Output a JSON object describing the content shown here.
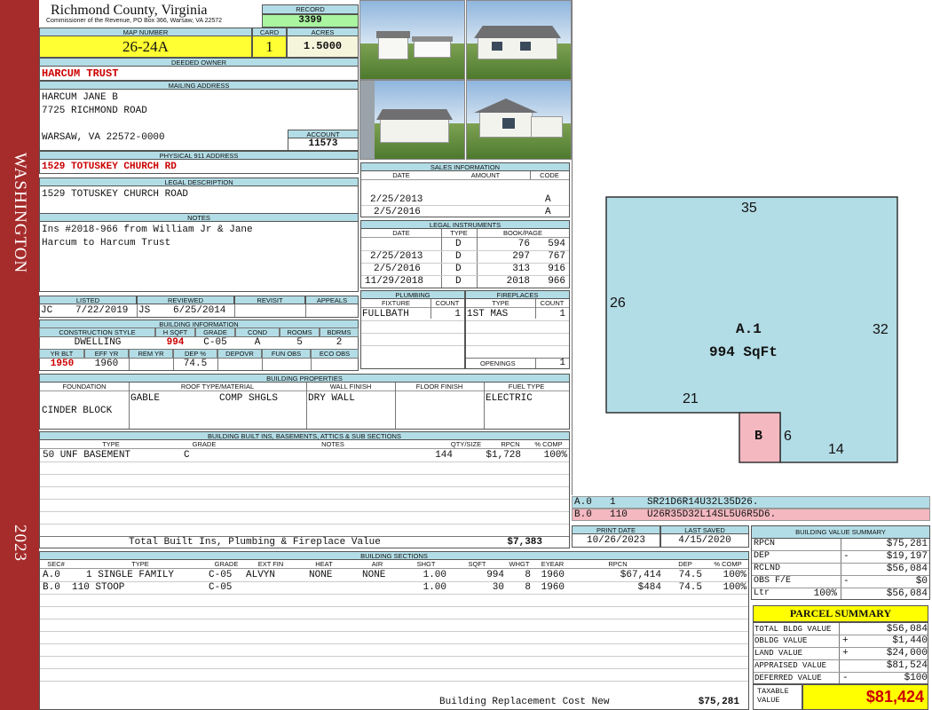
{
  "side": {
    "top": "WASHINGTON",
    "bottom": "2023"
  },
  "header": {
    "county": "Richmond County, Virginia",
    "commissioner": "Commissioner of the Revenue, PO Box 366, Warsaw, VA 22572",
    "record_label": "RECORD",
    "record": "3399",
    "map_label": "MAP NUMBER",
    "map": "26-24A",
    "card_label": "CARD",
    "card": "1",
    "acres_label": "ACRES",
    "acres": "1.5000"
  },
  "owner": {
    "label": "DEEDED OWNER",
    "name": "HARCUM TRUST"
  },
  "mailing": {
    "label": "MAILING ADDRESS",
    "line1": "HARCUM JANE B",
    "line2": "7725 RICHMOND ROAD",
    "line3": "WARSAW, VA 22572-0000",
    "account_label": "ACCOUNT",
    "account": "11573"
  },
  "physical": {
    "label": "PHYSICAL 911 ADDRESS",
    "address": "1529 TOTUSKEY CHURCH RD"
  },
  "legal": {
    "label": "LEGAL DESCRIPTION",
    "text": "1529 TOTUSKEY CHURCH ROAD"
  },
  "notes": {
    "label": "NOTES",
    "line1": "Ins #2018-966 from William Jr & Jane",
    "line2": "Harcum to Harcum Trust"
  },
  "sales": {
    "title": "SALES INFORMATION",
    "headers": [
      "DATE",
      "AMOUNT",
      "CODE"
    ],
    "rows": [
      {
        "date": "2/25/2013",
        "amount": "",
        "code": "A"
      },
      {
        "date": "2/5/2016",
        "amount": "",
        "code": "A"
      }
    ]
  },
  "legal_instruments": {
    "title": "LEGAL INSTRUMENTS",
    "headers": [
      "DATE",
      "TYPE",
      "BOOK/PAGE"
    ],
    "rows": [
      {
        "date": "",
        "type": "D",
        "book": "76",
        "page": "594"
      },
      {
        "date": "2/25/2013",
        "type": "D",
        "book": "297",
        "page": "767"
      },
      {
        "date": "2/5/2016",
        "type": "D",
        "book": "313",
        "page": "916"
      },
      {
        "date": "11/29/2018",
        "type": "D",
        "book": "2018",
        "page": "966"
      }
    ]
  },
  "listing": {
    "listed_label": "LISTED",
    "listed_by": "JC",
    "listed_date": "7/22/2019",
    "reviewed_label": "REVIEWED",
    "reviewed_by": "JS",
    "reviewed_date": "6/25/2014",
    "revisit_label": "REVISIT",
    "appeals_label": "APPEALS"
  },
  "building_info": {
    "title": "BUILDING INFORMATION",
    "h1": [
      "CONSTRUCTION STYLE",
      "H SQFT",
      "GRADE",
      "COND",
      "ROOMS",
      "BDRMS"
    ],
    "v1": [
      "DWELLING",
      "994",
      "C-05",
      "A",
      "5",
      "2"
    ],
    "h2": [
      "YR BLT",
      "EFF YR",
      "REM YR",
      "DEP %",
      "DEPOVR",
      "FUN OBS",
      "ECO OBS"
    ],
    "v2": [
      "1950",
      "1960",
      "",
      "74.5",
      "",
      "",
      ""
    ]
  },
  "plumbing": {
    "title": "PLUMBING",
    "headers": [
      "FIXTURE",
      "COUNT"
    ],
    "rows": [
      {
        "fixture": "FULLBATH",
        "count": "1"
      }
    ]
  },
  "fireplaces": {
    "title": "FIREPLACES",
    "headers": [
      "TYPE",
      "COUNT"
    ],
    "rows": [
      {
        "type": "1ST MAS",
        "count": "1"
      }
    ],
    "openings_label": "OPENINGS",
    "openings": "1"
  },
  "properties": {
    "title": "BUILDING PROPERTIES",
    "headers": [
      "FOUNDATION",
      "ROOF TYPE/MATERIAL",
      "WALL FINISH",
      "FLOOR FINISH",
      "FUEL TYPE"
    ],
    "foundation": "CINDER BLOCK",
    "roof_type": "GABLE",
    "roof_material": "COMP SHGLS",
    "wall": "DRY WALL",
    "floor": "",
    "fuel": "ELECTRIC"
  },
  "builtins": {
    "title": "BUILDING BUILT INS, BASEMENTS, ATTICS & SUB SECTIONS",
    "headers": [
      "TYPE",
      "GRADE",
      "NOTES",
      "QTY/SIZE",
      "RPCN",
      "% COMP"
    ],
    "rows": [
      {
        "type": "50 UNF BASEMENT",
        "grade": "C",
        "notes": "",
        "qty": "144",
        "rpcn": "$1,728",
        "comp": "100%"
      }
    ],
    "total_label": "Total Built Ins, Plumbing & Fireplace Value",
    "total": "$7,383"
  },
  "sections": {
    "title": "BUILDING SECTIONS",
    "headers": [
      "SEC#",
      "TYPE",
      "GRADE",
      "EXT FIN",
      "HEAT",
      "AIR",
      "SHGT",
      "SQFT",
      "WHGT",
      "EYEAR",
      "RPCN",
      "DEP",
      "% COMP"
    ],
    "rows": [
      {
        "sec": "A.0",
        "type": "1 SINGLE FAMILY",
        "grade": "C-05",
        "ext": "ALVYN",
        "heat": "NONE",
        "air": "NONE",
        "shgt": "1.00",
        "sqft": "994",
        "whgt": "8",
        "eyear": "1960",
        "rpcn": "$67,414",
        "dep": "74.5",
        "comp": "100%"
      },
      {
        "sec": "B.0",
        "type": "110 STOOP",
        "grade": "C-05",
        "ext": "",
        "heat": "",
        "air": "",
        "shgt": "1.00",
        "sqft": "30",
        "whgt": "8",
        "eyear": "1960",
        "rpcn": "$484",
        "dep": "74.5",
        "comp": "100%"
      }
    ],
    "replacement_label": "Building Replacement Cost New",
    "replacement": "$75,281"
  },
  "sketch": {
    "area_label": "A.1",
    "area_sqft": "994 SqFt",
    "stoop_label": "B",
    "dims": {
      "top": "35",
      "left": "26",
      "right": "32",
      "notch": "21",
      "stoop": "6",
      "bottom": "14"
    },
    "area_color": "#b3dde6",
    "stoop_color": "#f4b8c0"
  },
  "vectors": [
    {
      "sec": "A.0",
      "code": "1",
      "vector": "SR21D6R14U32L35D26."
    },
    {
      "sec": "B.0",
      "code": "110",
      "vector": "U26R35D32L14SL5U6R5D6."
    }
  ],
  "dates": {
    "print_label": "PRINT DATE",
    "print": "10/26/2023",
    "saved_label": "LAST SAVED",
    "saved": "4/15/2020"
  },
  "value_summary": {
    "title": "BUILDING VALUE SUMMARY",
    "rows": [
      {
        "label": "RPCN",
        "sign": "",
        "value": "$75,281"
      },
      {
        "label": "DEP",
        "sign": "-",
        "value": "$19,197"
      },
      {
        "label": "RCLND",
        "sign": "",
        "value": "$56,084"
      },
      {
        "label": "OBS F/E",
        "sign": "-",
        "value": "$0"
      },
      {
        "label": "Ltr",
        "pct": "100%",
        "sign": "",
        "value": "$56,084"
      }
    ]
  },
  "parcel": {
    "title": "PARCEL SUMMARY",
    "rows": [
      {
        "label": "TOTAL BLDG VALUE",
        "sign": "",
        "value": "$56,084"
      },
      {
        "label": "OBLDG VALUE",
        "sign": "+",
        "value": "$1,440"
      },
      {
        "label": "LAND VALUE",
        "sign": "+",
        "value": "$24,000"
      },
      {
        "label": "APPRAISED VALUE",
        "sign": "",
        "value": "$81,524"
      },
      {
        "label": "DEFERRED VALUE",
        "sign": "-",
        "value": "$100"
      }
    ],
    "taxable_label": "TAXABLE VALUE",
    "taxable": "$81,424",
    "highlight": "#ffff00"
  }
}
